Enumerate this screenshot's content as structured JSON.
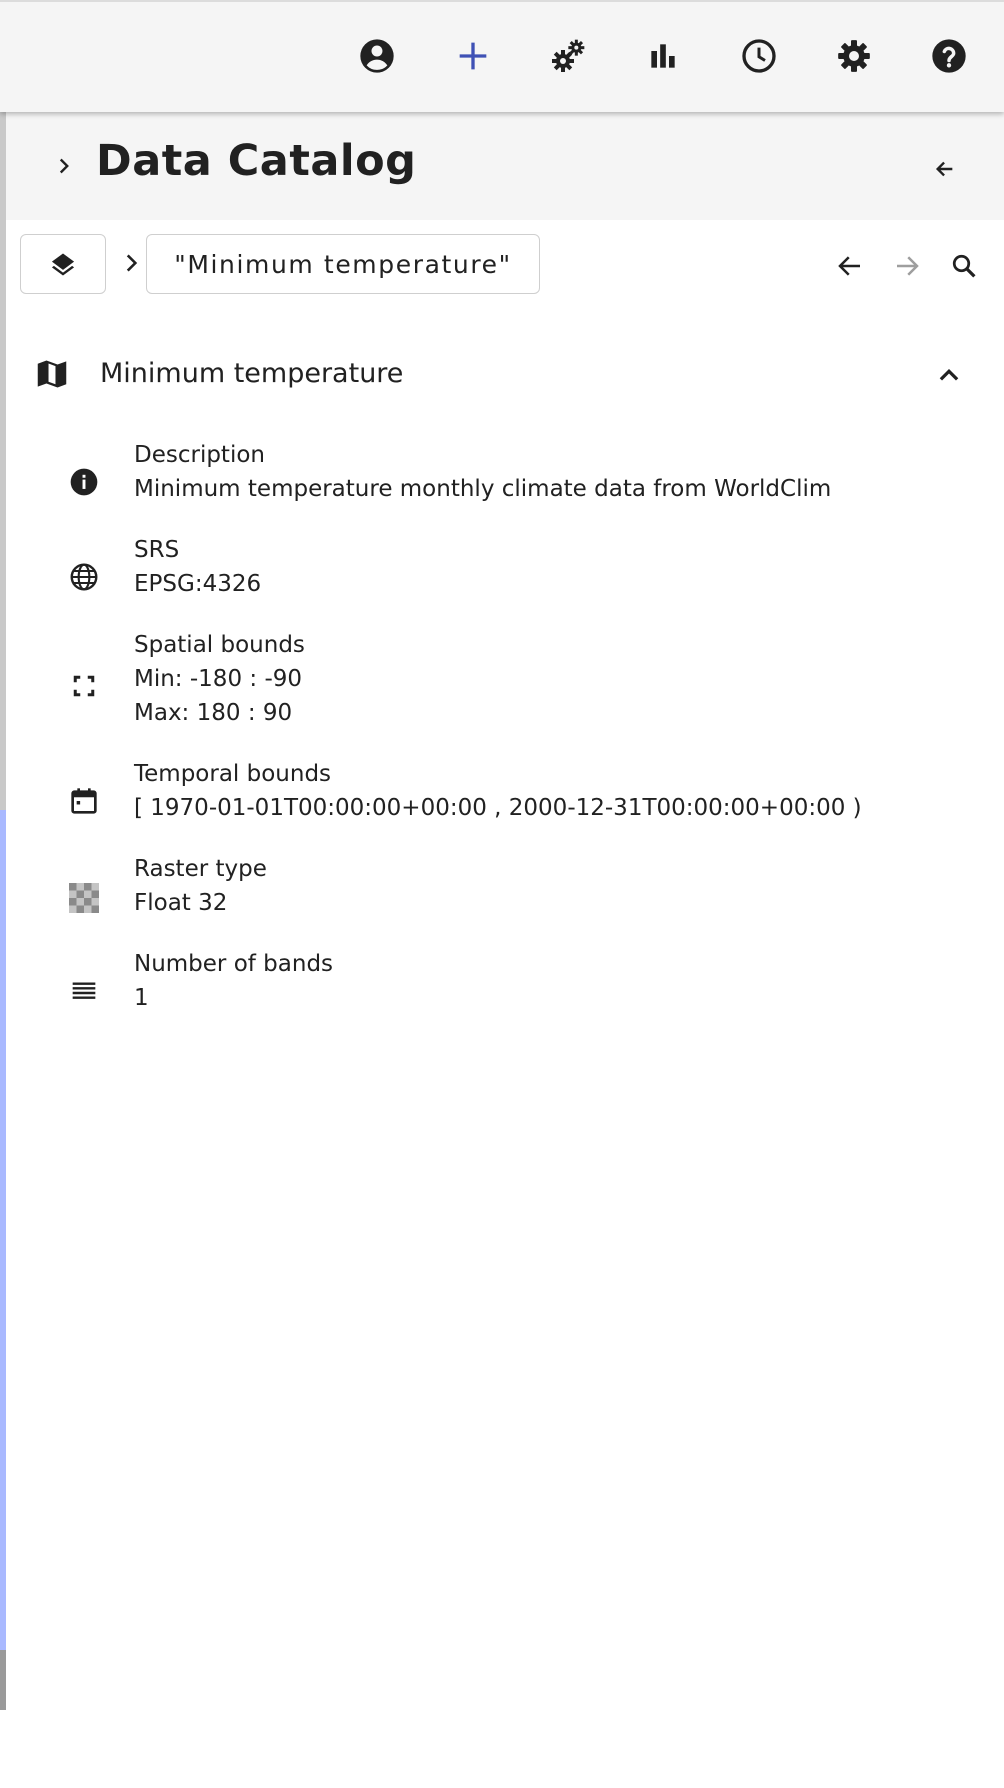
{
  "toolbar": {
    "items": [
      {
        "icon": "account-circle-icon"
      },
      {
        "icon": "add-icon",
        "color": "#3f51b5"
      },
      {
        "icon": "operators-gears-icon"
      },
      {
        "icon": "bar-chart-icon"
      },
      {
        "icon": "clock-icon"
      },
      {
        "icon": "settings-gear-icon"
      },
      {
        "icon": "help-icon"
      }
    ]
  },
  "panel": {
    "title": "Data Catalog"
  },
  "breadcrumb": {
    "current": "\"Minimum temperature\""
  },
  "layer": {
    "name": "Minimum temperature",
    "properties": [
      {
        "label": "Description",
        "values": [
          "Minimum temperature monthly climate data from WorldClim"
        ],
        "icon": "info-icon"
      },
      {
        "label": "SRS",
        "values": [
          "EPSG:4326"
        ],
        "icon": "globe-icon"
      },
      {
        "label": "Spatial bounds",
        "values": [
          "Min: -180 : -90",
          "Max: 180 : 90"
        ],
        "icon": "fullscreen-bounds-icon"
      },
      {
        "label": "Temporal bounds",
        "values": [
          "[ 1970-01-01T00:00:00+00:00 , 2000-12-31T00:00:00+00:00 )"
        ],
        "icon": "calendar-icon"
      },
      {
        "label": "Raster type",
        "values": [
          "Float 32"
        ],
        "icon": "raster-checker-icon"
      },
      {
        "label": "Number of bands",
        "values": [
          "1"
        ],
        "icon": "bands-lines-icon"
      }
    ]
  },
  "colors": {
    "accent": "#3f51b5",
    "toolbar_bg": "#f5f5f5",
    "text": "#212121"
  }
}
